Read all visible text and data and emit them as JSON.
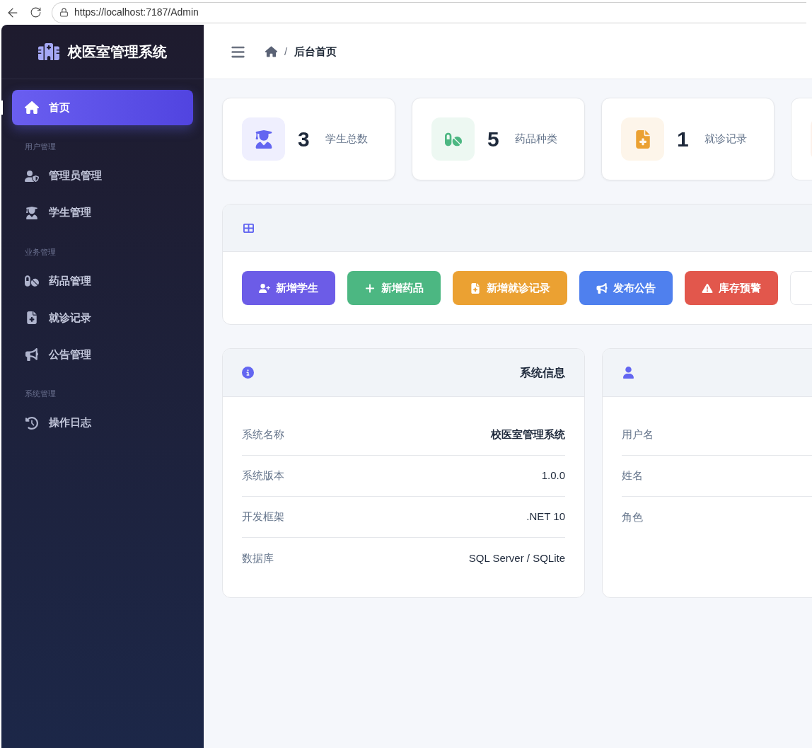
{
  "browser": {
    "url": "https://localhost:7187/Admin"
  },
  "sidebar": {
    "title": "校医室管理系统",
    "nav": [
      {
        "kind": "link",
        "label": "首页",
        "selected": true
      },
      {
        "kind": "heading",
        "label": "用户管理"
      },
      {
        "kind": "link",
        "label": "管理员管理",
        "selected": false
      },
      {
        "kind": "link",
        "label": "学生管理",
        "selected": false
      },
      {
        "kind": "heading",
        "label": "业务管理"
      },
      {
        "kind": "link",
        "label": "药品管理",
        "selected": false
      },
      {
        "kind": "link",
        "label": "就诊记录",
        "selected": false
      },
      {
        "kind": "link",
        "label": "公告管理",
        "selected": false
      },
      {
        "kind": "heading",
        "label": "系统管理"
      },
      {
        "kind": "link",
        "label": "操作日志",
        "selected": false
      }
    ]
  },
  "topbar": {
    "separator": "/",
    "current": "后台首页"
  },
  "stats": [
    {
      "kind": "stat",
      "value": "3",
      "label": "学生总数",
      "color": "#6366f1"
    },
    {
      "kind": "stat",
      "value": "5",
      "label": "药品种类",
      "color": "#4cb782"
    },
    {
      "kind": "stat",
      "value": "1",
      "label": "就诊记录",
      "color": "#eba132"
    },
    {
      "kind": "cut"
    }
  ],
  "quick_actions": [
    {
      "label": "新增学生",
      "color": "#6c5ce7"
    },
    {
      "label": "新增药品",
      "color": "#4cb782"
    },
    {
      "label": "新增就诊记录",
      "color": "#eba132"
    },
    {
      "label": "发布公告",
      "color": "#4f80ee"
    },
    {
      "label": "库存预警",
      "color": "#e2574c"
    },
    {
      "color": "#ffffff"
    }
  ],
  "system_info": {
    "title": "系统信息",
    "rows": [
      {
        "label": "系统名称",
        "value": "校医室管理系统",
        "bold": true
      },
      {
        "label": "系统版本",
        "value": "1.0.0",
        "bold": false
      },
      {
        "label": "开发框架",
        "value": ".NET 10",
        "bold": false
      },
      {
        "label": "数据库",
        "value": "SQL Server / SQLite",
        "bold": false
      }
    ]
  },
  "user_info": {
    "rows": [
      {
        "label": "用户名"
      },
      {
        "label": "姓名"
      },
      {
        "label": "角色"
      }
    ]
  }
}
